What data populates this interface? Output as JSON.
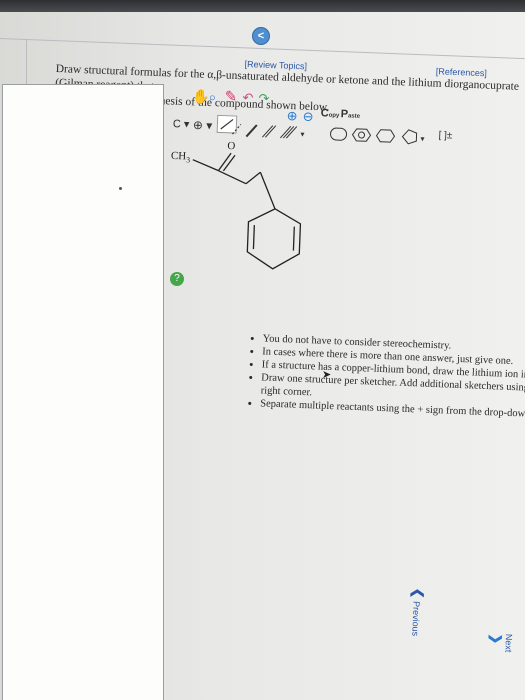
{
  "header": {
    "review_topics": "[Review Topics]",
    "references": "[References]"
  },
  "question": {
    "prompt_line1": "Draw structural formulas for the α,β-unsaturated aldehyde or ketone and the lithium diorganocuprate (Gilman reagent) that",
    "prompt_line2": "could be used in a synthesis of the compound shown below.",
    "molecule_label": "CH",
    "molecule_sub": "3",
    "oxygen": "O"
  },
  "instructions": [
    "You do not have to consider stereochemistry.",
    "In cases where there is more than one answer, just give one.",
    "If a structure has a copper-lithium bond, draw the lithium ion in a separate sketcher.",
    "Draw one structure per sketcher. Add additional sketchers using the drop-down menu in the bottom right corner.",
    "Separate multiple reactants using the + sign from the drop-down menu."
  ],
  "toolbar": {
    "copy_label": "C",
    "copy_sub": "opy",
    "paste_label": "P",
    "paste_sub": "aste",
    "bracket_label": "[ ]±",
    "collapse_label": "<"
  },
  "footer": {
    "previous": "Previous",
    "next": "Next"
  }
}
